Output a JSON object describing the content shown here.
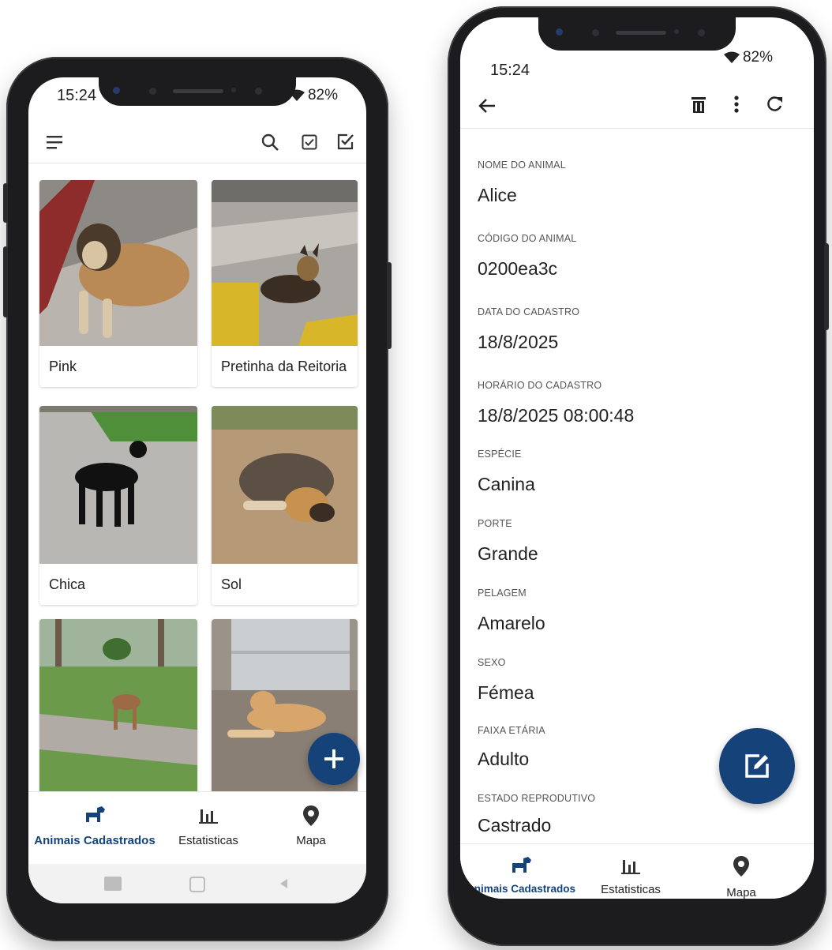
{
  "status": {
    "time": "15:24",
    "battery": "82%"
  },
  "list_screen": {
    "animals": [
      {
        "name": "Pink"
      },
      {
        "name": "Pretinha da Reitoria"
      },
      {
        "name": "Chica"
      },
      {
        "name": "Sol"
      },
      {
        "name": ""
      },
      {
        "name": ""
      }
    ],
    "fab_icon": "add-icon"
  },
  "detail_screen": {
    "fields": [
      {
        "label": "NOME DO ANIMAL",
        "value": "Alice"
      },
      {
        "label": "CÓDIGO DO ANIMAL",
        "value": "0200ea3c"
      },
      {
        "label": "DATA DO CADASTRO",
        "value": "18/8/2025"
      },
      {
        "label": "HORÁRIO DO CADASTRO",
        "value": "18/8/2025 08:00:48"
      },
      {
        "label": "ESPÉCIE",
        "value": "Canina"
      },
      {
        "label": "PORTE",
        "value": "Grande"
      },
      {
        "label": "PELAGEM",
        "value": "Amarelo"
      },
      {
        "label": "SEXO",
        "value": "Fémea"
      },
      {
        "label": "FAIXA ETÁRIA",
        "value": "Adulto"
      },
      {
        "label": "ESTADO REPRODUTIVO",
        "value": "Castrado"
      }
    ],
    "fab_icon": "edit-icon"
  },
  "bottom_nav": {
    "items": [
      {
        "label": "Animais Cadastrados",
        "icon": "dog-icon",
        "active": true
      },
      {
        "label": "Estatisticas",
        "icon": "bar-chart-icon",
        "active": false
      },
      {
        "label": "Mapa",
        "icon": "map-pin-icon",
        "active": false
      }
    ]
  },
  "colors": {
    "primary": "#16427a",
    "text": "#222222",
    "label": "#555555"
  }
}
